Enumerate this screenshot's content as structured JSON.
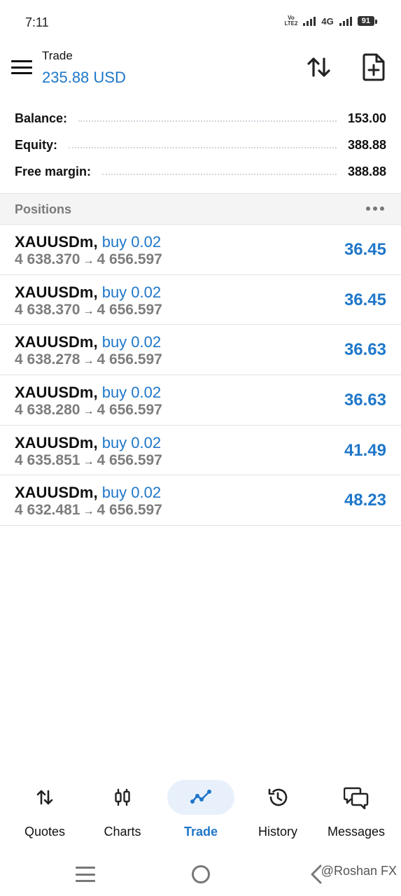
{
  "status_bar": {
    "time": "7:11",
    "volte_top": "Vo",
    "volte_bottom": "LTE2",
    "network": "4G",
    "battery": "91"
  },
  "header": {
    "title": "Trade",
    "amount": "235.88 USD"
  },
  "summary": [
    {
      "label": "Balance:",
      "value": "153.00"
    },
    {
      "label": "Equity:",
      "value": "388.88"
    },
    {
      "label": "Free margin:",
      "value": "388.88"
    }
  ],
  "positions": {
    "title": "Positions",
    "items": [
      {
        "symbol": "XAUUSDm,",
        "side": "buy 0.02",
        "open_price": "4 638.370",
        "current_price": "4 656.597",
        "profit": "36.45"
      },
      {
        "symbol": "XAUUSDm,",
        "side": "buy 0.02",
        "open_price": "4 638.370",
        "current_price": "4 656.597",
        "profit": "36.45"
      },
      {
        "symbol": "XAUUSDm,",
        "side": "buy 0.02",
        "open_price": "4 638.278",
        "current_price": "4 656.597",
        "profit": "36.63"
      },
      {
        "symbol": "XAUUSDm,",
        "side": "buy 0.02",
        "open_price": "4 638.280",
        "current_price": "4 656.597",
        "profit": "36.63"
      },
      {
        "symbol": "XAUUSDm,",
        "side": "buy 0.02",
        "open_price": "4 635.851",
        "current_price": "4 656.597",
        "profit": "41.49"
      },
      {
        "symbol": "XAUUSDm,",
        "side": "buy 0.02",
        "open_price": "4 632.481",
        "current_price": "4 656.597",
        "profit": "48.23"
      }
    ]
  },
  "nav": {
    "items": [
      {
        "label": "Quotes",
        "icon": "quotes-arrows-icon"
      },
      {
        "label": "Charts",
        "icon": "candlestick-icon"
      },
      {
        "label": "Trade",
        "icon": "trade-line-icon",
        "active": true
      },
      {
        "label": "History",
        "icon": "history-clock-icon"
      },
      {
        "label": "Messages",
        "icon": "messages-icon"
      }
    ]
  },
  "watermark": "@Roshan FX",
  "colors": {
    "accent": "#1f77c9",
    "text": "#111111",
    "muted": "#7d7d7d",
    "section_bg": "#f4f4f5",
    "active_nav_bg": "#e8f1fb"
  }
}
